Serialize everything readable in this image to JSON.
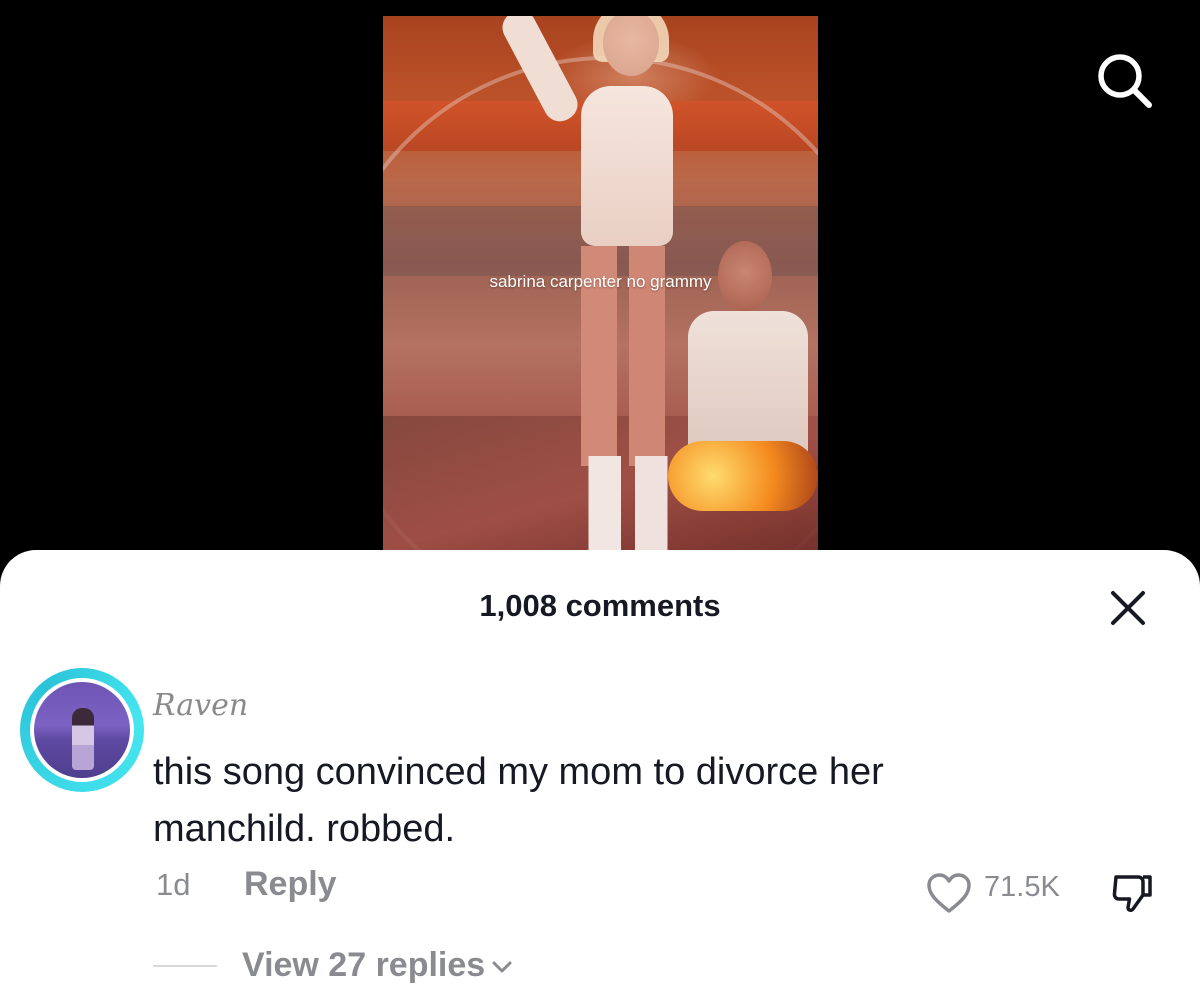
{
  "video": {
    "caption": "sabrina carpenter no grammy"
  },
  "top_bar": {
    "search_icon": "search-icon"
  },
  "comments_sheet": {
    "title": "1,008 comments",
    "close_icon": "close-icon",
    "comment": {
      "username": "Raven",
      "text": "this song convinced my mom to divorce her manchild. robbed.",
      "time": "1d",
      "reply_label": "Reply",
      "like_icon": "heart-outline-icon",
      "like_count": "71.5K",
      "dislike_icon": "thumbs-down-icon",
      "view_replies_label": "View 27 replies",
      "view_replies_icon": "chevron-down-icon"
    },
    "colors": {
      "avatar_ring": "#3dd9e8",
      "muted_text": "#8a8b91",
      "primary_text": "#161823"
    }
  }
}
